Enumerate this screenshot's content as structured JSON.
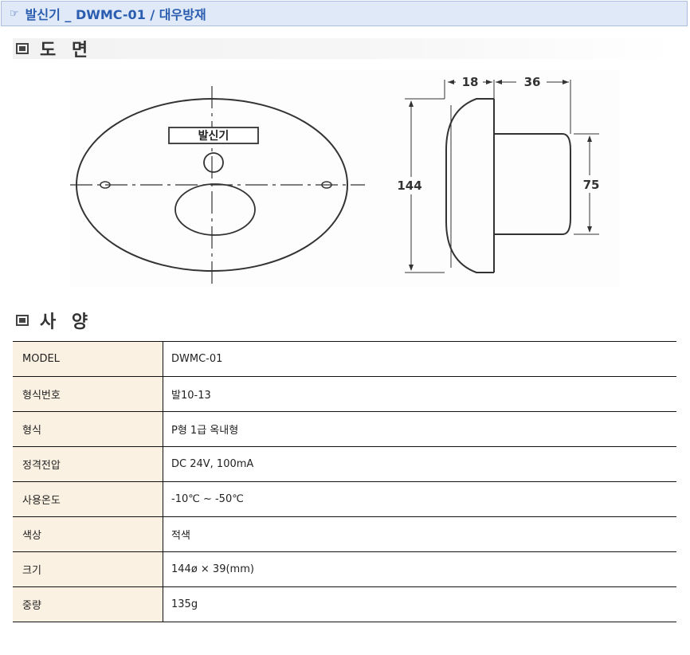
{
  "header": {
    "title": "발신기 _ DWMC-01 / 대우방재",
    "icon": "pointing-hand-icon"
  },
  "sections": {
    "drawing": "도 면",
    "spec": "사 양"
  },
  "drawing": {
    "front_label": "발신기",
    "dim_top_left": "18",
    "dim_top_right": "36",
    "dim_height": "144",
    "dim_inner": "75"
  },
  "spec_table": [
    {
      "key": "MODEL",
      "value": "DWMC-01"
    },
    {
      "key": "형식번호",
      "value": "발10-13"
    },
    {
      "key": "형식",
      "value": "P형 1급 옥내형"
    },
    {
      "key": "정격전압",
      "value": "DC 24V, 100mA"
    },
    {
      "key": "사용온도",
      "value": "-10℃ ~ -50℃"
    },
    {
      "key": "색상",
      "value": "적색"
    },
    {
      "key": "크기",
      "value": "144ø × 39(mm)"
    },
    {
      "key": "중량",
      "value": "135g"
    }
  ]
}
